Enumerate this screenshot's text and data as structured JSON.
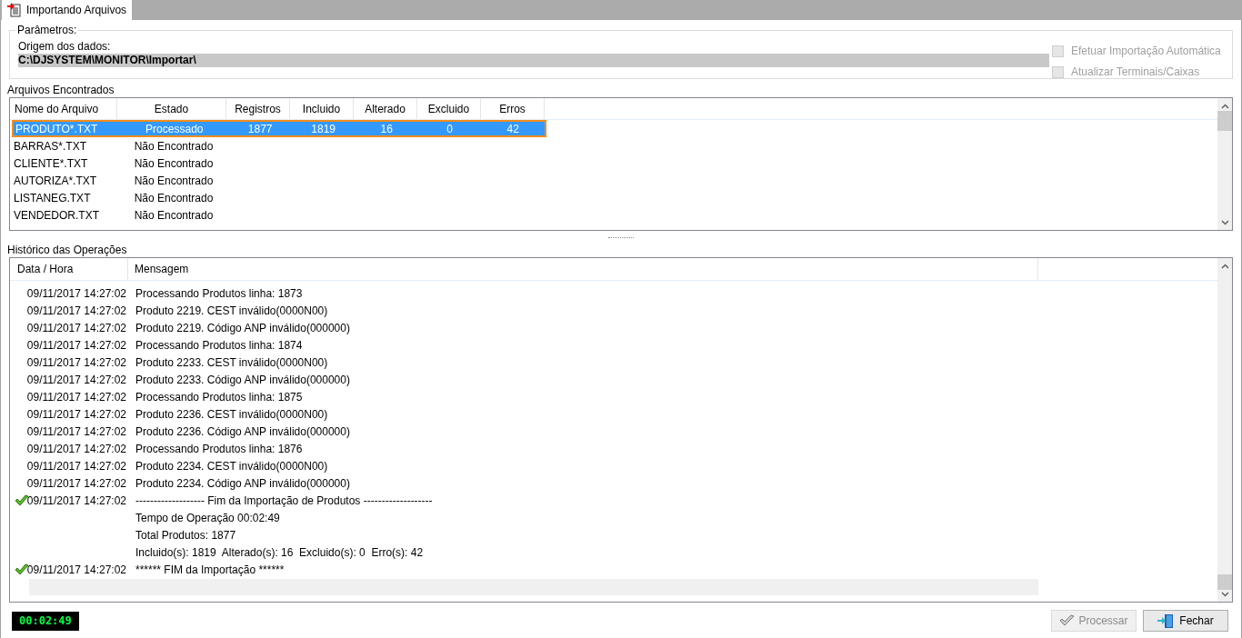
{
  "tab": {
    "label": "Importando Arquivos",
    "selected": true
  },
  "parameters": {
    "title": "Parâmetros:",
    "source_label": "Origem dos dados:",
    "source_value": "C:\\DJSYSTEM\\MONITOR\\Importar\\",
    "options": [
      {
        "label": "Efetuar Importação Automática",
        "checked": false,
        "disabled": true
      },
      {
        "label": "Atualizar Terminais/Caixas",
        "checked": false,
        "disabled": true
      }
    ]
  },
  "files": {
    "title": "Arquivos Encontrados",
    "columns": [
      "Nome do Arquivo",
      "Estado",
      "Registros",
      "Incluido",
      "Alterado",
      "Excluido",
      "Erros"
    ],
    "rows": [
      {
        "selected": true,
        "cells": [
          "PRODUTO*.TXT",
          "Processado",
          "1877",
          "1819",
          "16",
          "0",
          "42"
        ]
      },
      {
        "selected": false,
        "cells": [
          "BARRAS*.TXT",
          "Não Encontrado"
        ]
      },
      {
        "selected": false,
        "cells": [
          "CLIENTE*.TXT",
          "Não Encontrado"
        ]
      },
      {
        "selected": false,
        "cells": [
          "AUTORIZA*.TXT",
          "Não Encontrado"
        ]
      },
      {
        "selected": false,
        "cells": [
          "LISTANEG.TXT",
          "Não Encontrado"
        ]
      },
      {
        "selected": false,
        "cells": [
          "VENDEDOR.TXT",
          "Não Encontrado"
        ]
      }
    ]
  },
  "history": {
    "title": "Histórico das Operações",
    "columns": [
      "Data / Hora",
      "Mensagem"
    ],
    "rows": [
      {
        "ok": false,
        "date": "09/11/2017 14:27:02",
        "message": "Processando Produtos linha: 1873"
      },
      {
        "ok": false,
        "date": "09/11/2017 14:27:02",
        "message": "Produto 2219. CEST inválido(0000N00)"
      },
      {
        "ok": false,
        "date": "09/11/2017 14:27:02",
        "message": "Produto 2219. Código ANP inválido(000000)"
      },
      {
        "ok": false,
        "date": "09/11/2017 14:27:02",
        "message": "Processando Produtos linha: 1874"
      },
      {
        "ok": false,
        "date": "09/11/2017 14:27:02",
        "message": "Produto 2233. CEST inválido(0000N00)"
      },
      {
        "ok": false,
        "date": "09/11/2017 14:27:02",
        "message": "Produto 2233. Código ANP inválido(000000)"
      },
      {
        "ok": false,
        "date": "09/11/2017 14:27:02",
        "message": "Processando Produtos linha: 1875"
      },
      {
        "ok": false,
        "date": "09/11/2017 14:27:02",
        "message": "Produto 2236. CEST inválido(0000N00)"
      },
      {
        "ok": false,
        "date": "09/11/2017 14:27:02",
        "message": "Produto 2236. Código ANP inválido(000000)"
      },
      {
        "ok": false,
        "date": "09/11/2017 14:27:02",
        "message": "Processando Produtos linha: 1876"
      },
      {
        "ok": false,
        "date": "09/11/2017 14:27:02",
        "message": "Produto 2234. CEST inválido(0000N00)"
      },
      {
        "ok": false,
        "date": "09/11/2017 14:27:02",
        "message": "Produto 2234. Código ANP inválido(000000)"
      },
      {
        "ok": true,
        "date": "09/11/2017 14:27:02",
        "message": "------------------- Fim da Importação de Produtos -------------------"
      },
      {
        "ok": false,
        "message": "Tempo de Operação 00:02:49"
      },
      {
        "ok": false,
        "message": "Total Produtos: 1877"
      },
      {
        "ok": false,
        "message": "Incluido(s): 1819  Alterado(s): 16  Excluido(s): 0  Erro(s): 42"
      },
      {
        "ok": true,
        "date": "09/11/2017 14:27:02",
        "message": "****** FIM da Importação ******"
      }
    ]
  },
  "timer": "00:02:49",
  "buttons": [
    {
      "label": "Processar",
      "kind": "process",
      "disabled": true
    },
    {
      "label": "Fechar",
      "kind": "close",
      "disabled": false
    }
  ]
}
